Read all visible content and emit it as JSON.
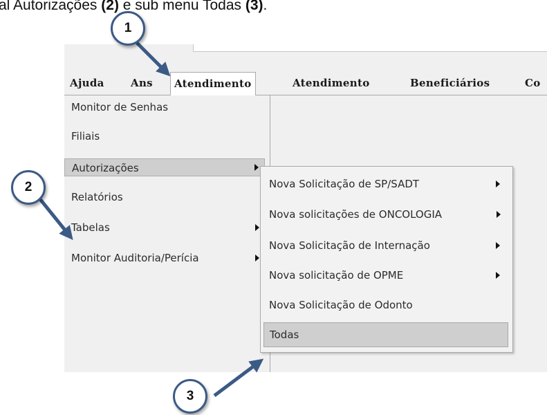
{
  "caption": {
    "part1": "al Autorizações ",
    "part2": "(2)",
    "part3": " e sub menu Todas ",
    "part4": "(3)",
    "part5": "."
  },
  "menubar": {
    "items": [
      "Ajuda",
      "Ans",
      "Atendimento",
      "Atendimento",
      "Beneficiários",
      "Co"
    ],
    "active_index": 2
  },
  "submenu1": {
    "items": [
      {
        "label": "Monitor de Senhas",
        "has_arrow": false
      },
      {
        "label": "Filiais",
        "has_arrow": false
      },
      {
        "label": "Autorizações",
        "has_arrow": true,
        "highlighted": true
      },
      {
        "label": "Relatórios",
        "has_arrow": false
      },
      {
        "label": "Tabelas",
        "has_arrow": true
      },
      {
        "label": "Monitor Auditoria/Perícia",
        "has_arrow": true
      }
    ]
  },
  "submenu2": {
    "items": [
      {
        "label": "Nova Solicitação de SP/SADT",
        "has_arrow": true
      },
      {
        "label": "Nova solicitações de ONCOLOGIA",
        "has_arrow": true
      },
      {
        "label": "Nova Solicitação de Internação",
        "has_arrow": true
      },
      {
        "label": "Nova solicitação de OPME",
        "has_arrow": true
      },
      {
        "label": "Nova Solicitação de Odonto",
        "has_arrow": false
      },
      {
        "label": "Todas",
        "has_arrow": false,
        "highlighted": true
      }
    ]
  },
  "callouts": [
    "1",
    "2",
    "3"
  ],
  "colors": {
    "arrow": "#3b5a86",
    "highlight": "#cfcfcf",
    "background": "#f0f0f0"
  }
}
